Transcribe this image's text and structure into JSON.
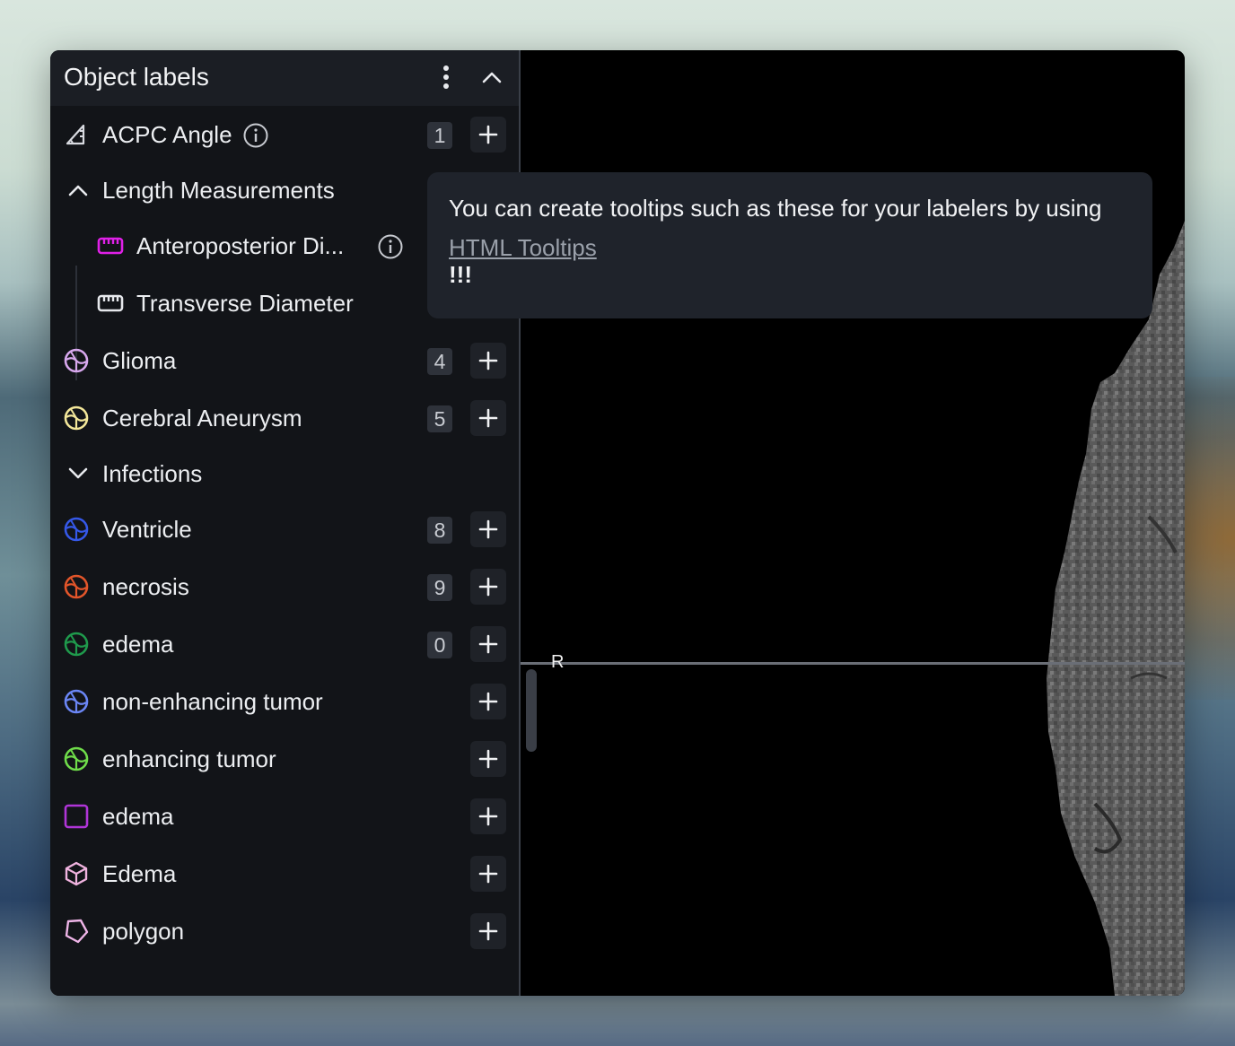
{
  "panel": {
    "title": "Object labels"
  },
  "rows": [
    {
      "label": "ACPC Angle",
      "count": "1",
      "icon": "angle-ruler-icon",
      "color": "#d8dae0",
      "has_info": true
    },
    {
      "label": "Length Measurements",
      "group": "expanded"
    },
    {
      "label": "Anteroposterior Di...",
      "icon": "ruler-icon",
      "color": "#e020e8",
      "has_info": true
    },
    {
      "label": "Transverse Diameter",
      "icon": "ruler-icon",
      "color": "#e6e8ec"
    },
    {
      "label": "Glioma",
      "count": "4",
      "icon": "brain-icon",
      "color": "#d8a8ee"
    },
    {
      "label": "Cerebral Aneurysm",
      "count": "5",
      "icon": "brain-icon",
      "color": "#f3e79a"
    },
    {
      "label": "Infections",
      "group": "collapsed"
    },
    {
      "label": "Ventricle",
      "count": "8",
      "icon": "brain-icon",
      "color": "#3558e8"
    },
    {
      "label": "necrosis",
      "count": "9",
      "icon": "brain-icon",
      "color": "#e2552a"
    },
    {
      "label": "edema",
      "count": "0",
      "icon": "brain-icon",
      "color": "#1f9a4c"
    },
    {
      "label": "non-enhancing tumor",
      "icon": "brain-icon",
      "color": "#6b86f5"
    },
    {
      "label": "enhancing tumor",
      "icon": "brain-icon",
      "color": "#6fdc4a"
    },
    {
      "label": "edema",
      "icon": "square-icon",
      "color": "#b035d8"
    },
    {
      "label": "Edema",
      "icon": "cube-icon",
      "color": "#f0b3df"
    },
    {
      "label": "polygon",
      "icon": "polygon-icon",
      "color": "#efb5e8"
    }
  ],
  "tooltip": {
    "text": "You can create tooltips such as these for your labelers by using",
    "link": "HTML Tooltips",
    "suffix": "!!!"
  },
  "viewer": {
    "orientation_label": "R"
  }
}
